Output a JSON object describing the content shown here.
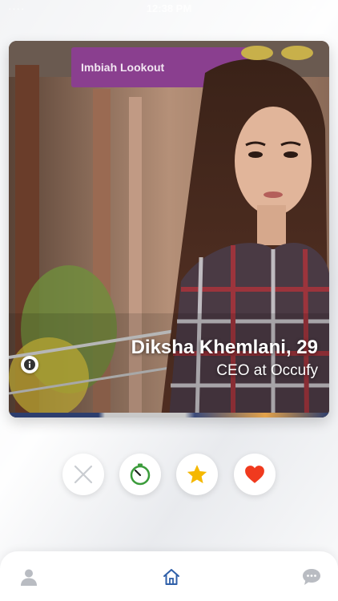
{
  "status_bar": {
    "carrier": "····",
    "time": "12:38 PM",
    "right": "↗ ▬"
  },
  "profile": {
    "name": "Diksha Khemlani, 29",
    "title": "CEO at Occufy",
    "photo_sign_text": "Imbiah Lookout"
  },
  "actions": {
    "dislike_icon": "close-icon",
    "timer_icon": "timer-icon",
    "star_icon": "star-icon",
    "like_icon": "heart-icon"
  },
  "tab_bar": {
    "items": [
      {
        "icon": "user-icon",
        "active": false
      },
      {
        "icon": "home-icon",
        "active": true
      },
      {
        "icon": "chat-icon",
        "active": false
      }
    ]
  },
  "colors": {
    "star": "#f5b800",
    "heart": "#f03a1e",
    "timer": "#3a9b3a",
    "home_active": "#2f5fa8",
    "inactive_icon": "#b9bcc2",
    "close": "#c9ccd1"
  }
}
